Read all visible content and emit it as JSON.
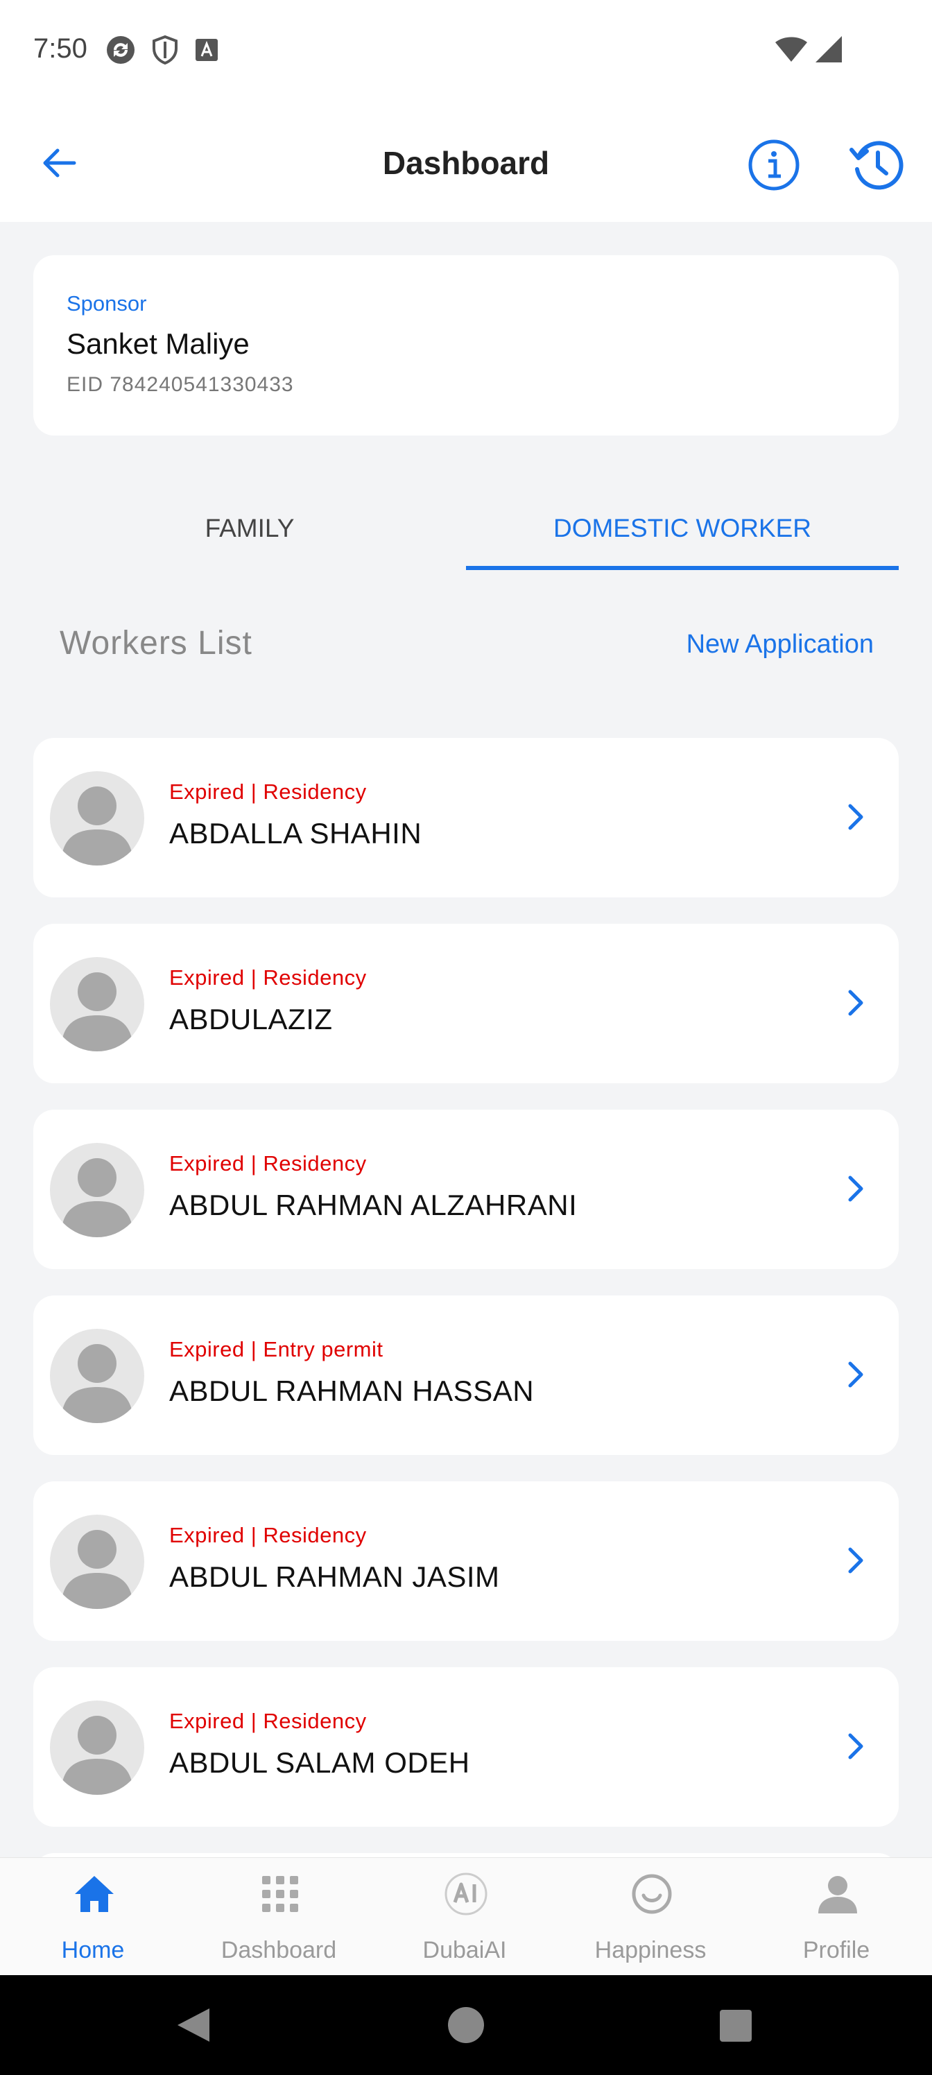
{
  "status_bar": {
    "time": "7:50"
  },
  "header": {
    "title": "Dashboard"
  },
  "sponsor": {
    "label": "Sponsor",
    "name": "Sanket Maliye",
    "eid": "EID 784240541330433"
  },
  "tabs": [
    {
      "label": "FAMILY",
      "active": false
    },
    {
      "label": "DOMESTIC WORKER",
      "active": true
    }
  ],
  "workers": {
    "title": "Workers List",
    "new_application": "New Application",
    "items": [
      {
        "status": "Expired | Residency",
        "name": "ABDALLA SHAHIN"
      },
      {
        "status": "Expired | Residency",
        "name": "ABDULAZIZ"
      },
      {
        "status": "Expired | Residency",
        "name": "ABDUL RAHMAN ALZAHRANI"
      },
      {
        "status": "Expired | Entry permit",
        "name": "ABDUL RAHMAN HASSAN"
      },
      {
        "status": "Expired | Residency",
        "name": "ABDUL RAHMAN JASIM"
      },
      {
        "status": "Expired | Residency",
        "name": "ABDUL SALAM ODEH"
      }
    ]
  },
  "bottom_nav": [
    {
      "label": "Home",
      "icon": "home-icon",
      "active": true
    },
    {
      "label": "Dashboard",
      "icon": "grid-icon",
      "active": false
    },
    {
      "label": "DubaiAI",
      "icon": "ai-icon",
      "active": false
    },
    {
      "label": "Happiness",
      "icon": "smiley-icon",
      "active": false
    },
    {
      "label": "Profile",
      "icon": "person-icon",
      "active": false
    }
  ],
  "colors": {
    "accent": "#1a73e8",
    "expired": "#e00000",
    "background": "#f3f4f6"
  }
}
